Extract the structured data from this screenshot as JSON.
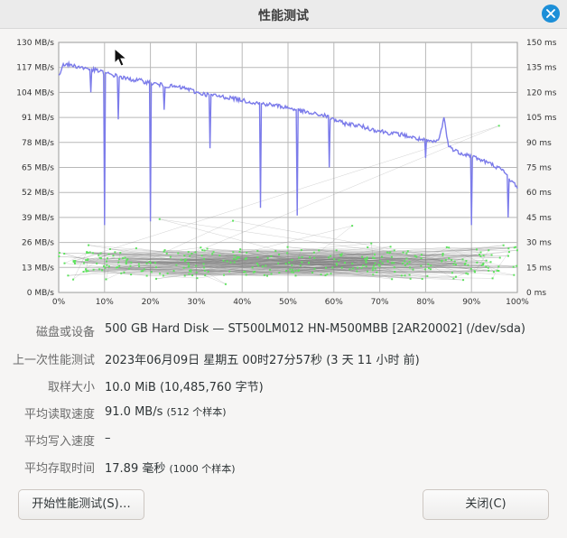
{
  "window": {
    "title": "性能测试"
  },
  "labels": {
    "disk": "磁盘或设备",
    "last_test": "上一次性能测试",
    "sample_size": "取样大小",
    "avg_read": "平均读取速度",
    "avg_write": "平均写入速度",
    "avg_access": "平均存取时间"
  },
  "values": {
    "disk": "500 GB Hard Disk — ST500LM012 HN-M500MBB [2AR20002] (/dev/sda)",
    "last_test": "2023年06月09日 星期五 00时27分57秒 (3 天 11 小时 前)",
    "sample_size": "10.0 MiB (10,485,760 字节)",
    "avg_read_main": "91.0 MB/s",
    "avg_read_note": "(512 个样本)",
    "avg_write": "–",
    "avg_access_main": "17.89 毫秒",
    "avg_access_note": "(1000 个样本)"
  },
  "buttons": {
    "start": "开始性能测试(S)…",
    "close": "关闭(C)"
  },
  "chart_data": {
    "type": "line",
    "x_ticks": [
      "0%",
      "10%",
      "20%",
      "30%",
      "40%",
      "50%",
      "60%",
      "70%",
      "80%",
      "90%",
      "100%"
    ],
    "y_left_ticks": [
      "0 MB/s",
      "13 MB/s",
      "26 MB/s",
      "39 MB/s",
      "52 MB/s",
      "65 MB/s",
      "78 MB/s",
      "91 MB/s",
      "104 MB/s",
      "117 MB/s",
      "130 MB/s"
    ],
    "y_right_ticks": [
      "0 ms",
      "15 ms",
      "30 ms",
      "45 ms",
      "60 ms",
      "75 ms",
      "90 ms",
      "105 ms",
      "120 ms",
      "135 ms",
      "150 ms"
    ],
    "y_left_range": [
      0,
      130
    ],
    "y_right_range": [
      0,
      150
    ],
    "grid": true,
    "colors": {
      "read": "#7b7bea",
      "access": "#5ee35e"
    },
    "read_rate": {
      "x": [
        0,
        1,
        3,
        5,
        7,
        9,
        10,
        12,
        15,
        18,
        20,
        22,
        25,
        28,
        30,
        32,
        35,
        38,
        40,
        42,
        45,
        48,
        50,
        52,
        55,
        58,
        60,
        62,
        65,
        68,
        70,
        72,
        75,
        78,
        80,
        82,
        83,
        84,
        85,
        87,
        90,
        92,
        95,
        97,
        99,
        100
      ],
      "mb_s": [
        112,
        119,
        118,
        117,
        116,
        115,
        114,
        113,
        111,
        110,
        109,
        108,
        107,
        106,
        104,
        103,
        102,
        101,
        100,
        99,
        98,
        97,
        96,
        95,
        93,
        92,
        90,
        88,
        87,
        85,
        84,
        83,
        82,
        80,
        79,
        78,
        80,
        91,
        76,
        73,
        71,
        69,
        66,
        63,
        57,
        55
      ]
    },
    "read_dips": {
      "x": [
        7,
        10,
        13,
        20,
        23,
        33,
        44,
        52,
        59,
        80,
        90,
        98
      ],
      "mb_s": [
        104,
        35,
        90,
        37,
        95,
        75,
        44,
        40,
        65,
        70,
        35,
        39
      ]
    },
    "access_time_ms": {
      "x_range": [
        0,
        100
      ],
      "typical_range": [
        10,
        30
      ],
      "outliers_ms": [
        44,
        43,
        40,
        100
      ]
    }
  }
}
